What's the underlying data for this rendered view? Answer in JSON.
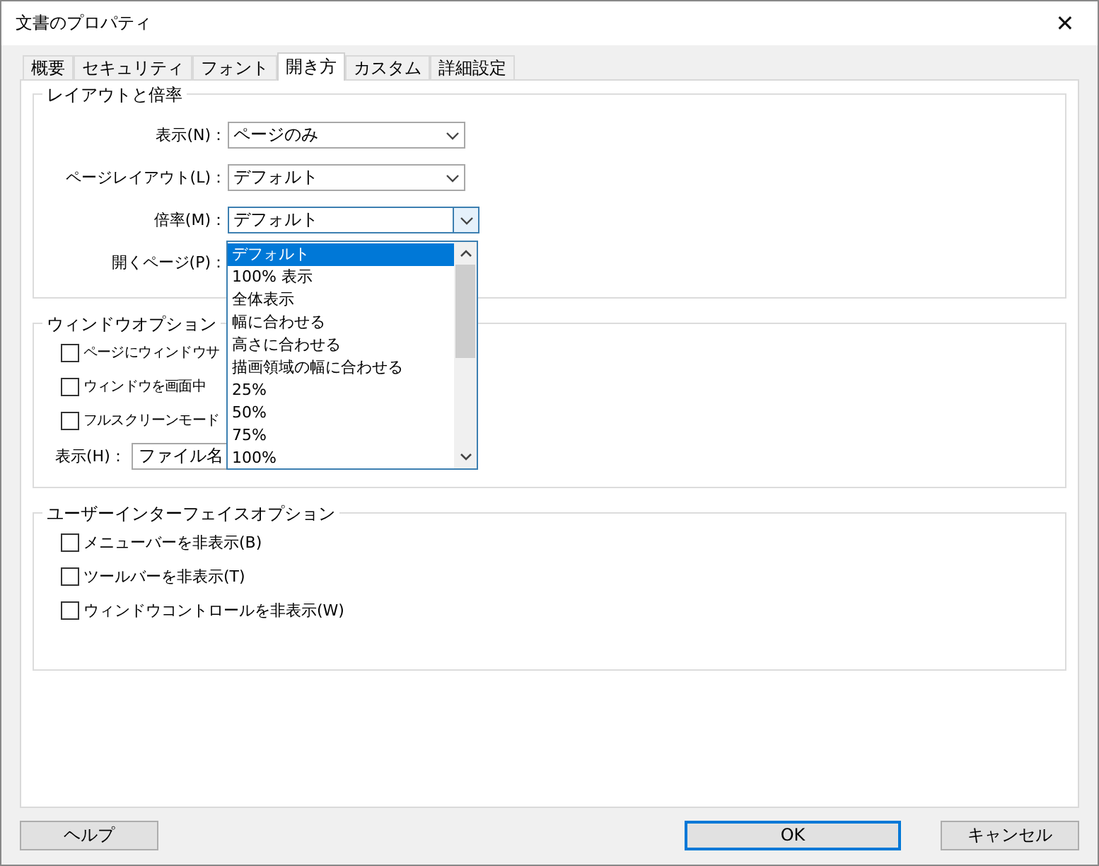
{
  "window": {
    "title": "文書のプロパティ",
    "close": "✕"
  },
  "tabs": [
    {
      "label": "概要",
      "selected": false
    },
    {
      "label": "セキュリティ",
      "selected": false
    },
    {
      "label": "フォント",
      "selected": false
    },
    {
      "label": "開き方",
      "selected": true
    },
    {
      "label": "カスタム",
      "selected": false
    },
    {
      "label": "詳細設定",
      "selected": false
    }
  ],
  "layout_group": {
    "title": "レイアウトと倍率",
    "fields": [
      {
        "label": "表示(N)：",
        "value": "ページのみ",
        "focused": false
      },
      {
        "label": "ページレイアウト(L)：",
        "value": "デフォルト",
        "focused": false
      },
      {
        "label": "倍率(M)：",
        "value": "デフォルト",
        "focused": true
      },
      {
        "label": "開くページ(P)："
      }
    ]
  },
  "zoom_list": {
    "items": [
      {
        "label": "デフォルト",
        "selected": true
      },
      {
        "label": "100% 表示",
        "selected": false
      },
      {
        "label": "全体表示",
        "selected": false
      },
      {
        "label": "幅に合わせる",
        "selected": false
      },
      {
        "label": "高さに合わせる",
        "selected": false
      },
      {
        "label": "描画領域の幅に合わせる",
        "selected": false
      },
      {
        "label": "25%",
        "selected": false
      },
      {
        "label": "50%",
        "selected": false
      },
      {
        "label": "75%",
        "selected": false
      },
      {
        "label": "100%",
        "selected": false
      }
    ]
  },
  "window_group": {
    "title": "ウィンドウオプション",
    "options": [
      {
        "label": "ページにウィンドウサ",
        "checked": false
      },
      {
        "label": "ウィンドウを画面中",
        "checked": false
      },
      {
        "label": "フルスクリーンモード",
        "checked": false
      }
    ],
    "display": {
      "label": "表示(H)：",
      "value": "ファイル名"
    }
  },
  "ui_group": {
    "title": "ユーザーインターフェイスオプション",
    "options": [
      {
        "label": "メニューバーを非表示(B)",
        "checked": false
      },
      {
        "label": "ツールバーを非表示(T)",
        "checked": false
      },
      {
        "label": "ウィンドウコントロールを非表示(W)",
        "checked": false
      }
    ]
  },
  "buttons": {
    "help": "ヘルプ",
    "ok": "OK",
    "cancel": "キャンセル"
  }
}
